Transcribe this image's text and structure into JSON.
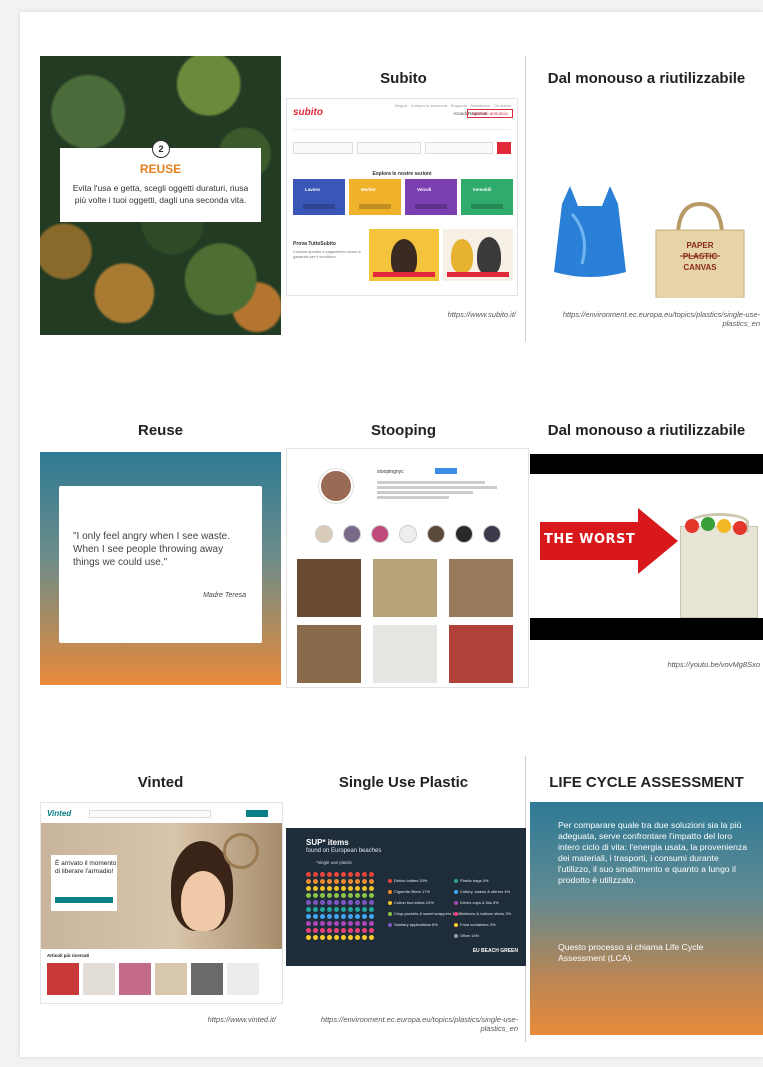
{
  "cells": {
    "c1": {
      "badge": "2",
      "heading": "REUSE",
      "body": "Evita l'usa e getta, scegli oggetti duraturi, riusa più volte i tuoi oggetti, dagli una seconda vita."
    },
    "c2": {
      "title": "Subito",
      "url": "https://www.subito.it/",
      "logo": "subito",
      "nav": "Negozi · Compra in sicurezza · Supporto · Assistenza · Chi siamo",
      "access": "Accedi  Registrati",
      "insert_button": "Inserisci annuncio",
      "categories_heading": "Esplora le nostre sezioni",
      "categories": [
        {
          "label": "Lavoro",
          "color": "#3a57b8"
        },
        {
          "label": "Market",
          "color": "#f0b22a"
        },
        {
          "label": "Veicoli",
          "color": "#7a3fb0"
        },
        {
          "label": "Immobili",
          "color": "#2fab6b"
        }
      ],
      "promo_title": "Prova TuttoSubito",
      "promo_text": "Compra spedito e pagamento sicuro e garanzia per il venditore."
    },
    "c3": {
      "title": "Dal monouso a riutilizzabile",
      "bag_text": "PAPER PLASTIC CANVAS",
      "url": "https://environment.ec.europa.eu/topics/plastics/single-use-plastics_en"
    },
    "c4": {
      "title": "Reuse",
      "quote": "\"I only feel angry when I see waste. When I see people throwing away things we could use.\"",
      "author": "Madre Teresa"
    },
    "c5": {
      "title": "Stooping",
      "handle": "stoopingnyc"
    },
    "c6": {
      "title": "Dal monouso a riutilizzabile",
      "arrow_text": "THE WORST",
      "url": "https://youtu.be/vovMg8Sxo"
    },
    "c7": {
      "title": "Vinted",
      "url": "https://www.vinted.it/",
      "logo": "Vinted",
      "hero_text": "È arrivato il momento di liberare l'armadio!",
      "items_label": "Articoli più ricercati"
    },
    "c8": {
      "title": "Single Use Plastic",
      "url": "https://environment.ec.europa.eu/topics/plastics/single-use-plastics_en",
      "headline": "SUP* items",
      "subheadline": "found on European beaches",
      "subnote": "*single use plastic",
      "legend": [
        {
          "label": "Drinks bottles 20%",
          "color": "#e8453c"
        },
        {
          "label": "Cigarette filters 17%",
          "color": "#f08a2a"
        },
        {
          "label": "Cotton bud sticks 10%",
          "color": "#f0c12a"
        },
        {
          "label": "Crisp packets & sweet wrappers 13%",
          "color": "#8bc34a"
        },
        {
          "label": "Sanitary applications 6%",
          "color": "#7e57c2"
        },
        {
          "label": "Plastic bags 4%",
          "color": "#26a69a"
        },
        {
          "label": "Cutlery, straws & stirrers 4%",
          "color": "#42a5f5"
        },
        {
          "label": "Drinks cups & lids 5%",
          "color": "#ab47bc"
        },
        {
          "label": "Balloons & balloon sticks 3%",
          "color": "#ec407a"
        },
        {
          "label": "Food containers 3%",
          "color": "#ffca28"
        },
        {
          "label": "Other 14%",
          "color": "#9e9e9e"
        }
      ],
      "brand": "EU BEACH GREEN"
    },
    "c9": {
      "title": "LIFE CYCLE ASSESSMENT",
      "p1": "Per comparare quale tra due soluzioni sia la più adeguata, serve confrontare l'impatto del loro intero ciclo di vita: l'energia usata, la provenienza dei materiali, i trasporti, i consumi durante l'utilizzo, il suo smaltimento e quanto a lungo il prodotto è utilizzato.",
      "p2": "Questo processo si chiama Life Cycle Assessment (LCA)."
    }
  }
}
